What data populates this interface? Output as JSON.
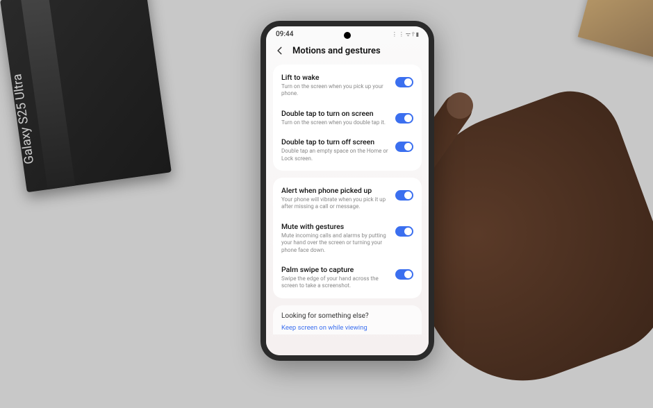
{
  "environment": {
    "box_label": "Galaxy S25 Ultra"
  },
  "statusBar": {
    "time": "09:44",
    "icons": "⋮ ⋮ ᯤ ⫯ ▮"
  },
  "header": {
    "title": "Motions and gestures"
  },
  "groups": [
    {
      "items": [
        {
          "title": "Lift to wake",
          "desc": "Turn on the screen when you pick up your phone.",
          "on": true
        },
        {
          "title": "Double tap to turn on screen",
          "desc": "Turn on the screen when you double tap it.",
          "on": true
        },
        {
          "title": "Double tap to turn off screen",
          "desc": "Double tap an empty space on the Home or Lock screen.",
          "on": true
        }
      ]
    },
    {
      "items": [
        {
          "title": "Alert when phone picked up",
          "desc": "Your phone will vibrate when you pick it up after missing a call or message.",
          "on": true
        },
        {
          "title": "Mute with gestures",
          "desc": "Mute incoming calls and alarms by putting your hand over the screen or turning your phone face down.",
          "on": true
        },
        {
          "title": "Palm swipe to capture",
          "desc": "Swipe the edge of your hand across the screen to take a screenshot.",
          "on": true
        }
      ]
    }
  ],
  "footer": {
    "heading": "Looking for something else?",
    "link": "Keep screen on while viewing"
  }
}
